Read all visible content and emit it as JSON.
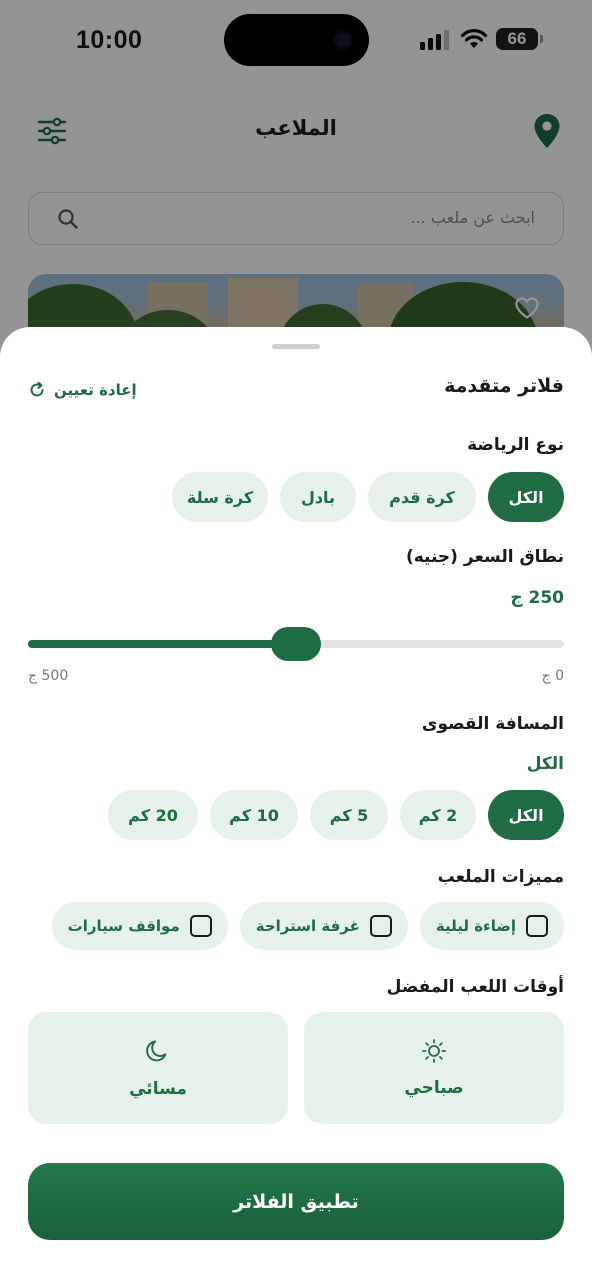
{
  "status_bar": {
    "time": "10:00",
    "battery": "66"
  },
  "header": {
    "title": "الملاعب"
  },
  "search": {
    "placeholder": "ابحث عن ملعب ..."
  },
  "sheet": {
    "title": "فلاتر متقدمة",
    "reset_label": "إعادة تعيين",
    "sport_type": {
      "label": "نوع الرياضة",
      "options": [
        "الكل",
        "كرة قدم",
        "بادل",
        "كرة سلة"
      ],
      "selected": "الكل"
    },
    "price_range": {
      "label": "نطاق السعر (جنيه)",
      "value_label": "250 ج",
      "value": 250,
      "min": 0,
      "max": 500,
      "min_label": "0 ج",
      "max_label": "500 ج"
    },
    "max_distance": {
      "label": "المسافة القصوى",
      "value_label": "الكل",
      "options": [
        "الكل",
        "2 كم",
        "5 كم",
        "10 كم",
        "20 كم"
      ],
      "selected": "الكل"
    },
    "features": {
      "label": "مميزات الملعب",
      "options": [
        "إضاءة ليلية",
        "غرفة استراحة",
        "مواقف سيارات"
      ]
    },
    "play_times": {
      "label": "أوقات اللعب المفضل",
      "morning_label": "صباحي",
      "evening_label": "مسائي"
    },
    "apply_label": "تطبيق الفلاتر"
  },
  "colors": {
    "primary": "#1e6b44",
    "chip_bg": "#e6f2e9",
    "overlay": "rgba(0,0,0,0.42)"
  },
  "icons": {
    "filter": "sliders-icon",
    "location": "map-pin-icon",
    "search": "magnifier-icon",
    "favorite": "heart-icon",
    "reset": "refresh-icon",
    "morning": "sun-icon",
    "evening": "moon-icon"
  }
}
